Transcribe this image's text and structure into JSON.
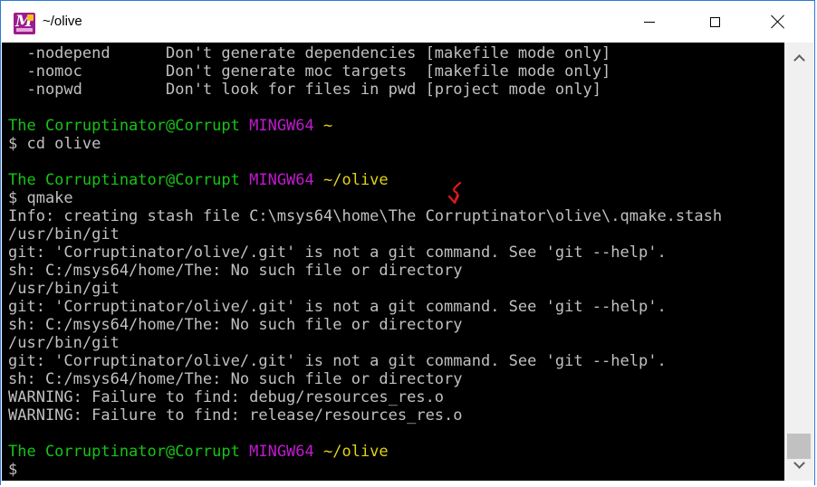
{
  "window": {
    "title": "~/olive",
    "app_icon": "mingw-msys-icon",
    "border_color": "#2b79d6"
  },
  "terminal": {
    "colors": {
      "background": "#000000",
      "text": "#c0c0c0",
      "user": "#17c317",
      "system": "#c21ad0",
      "path": "#dfd21a",
      "annotation": "#e01818"
    },
    "lines": [
      {
        "segments": [
          {
            "text": "  -nodepend      Don't generate dependencies [makefile mode only]",
            "color": "white"
          }
        ]
      },
      {
        "segments": [
          {
            "text": "  -nomoc         Don't generate moc targets  [makefile mode only]",
            "color": "white"
          }
        ]
      },
      {
        "segments": [
          {
            "text": "  -nopwd         Don't look for files in pwd [project mode only]",
            "color": "white"
          }
        ]
      },
      {
        "segments": [
          {
            "text": "",
            "color": "white"
          }
        ]
      },
      {
        "segments": [
          {
            "text": "The Corruptinator@Corrupt",
            "color": "green"
          },
          {
            "text": " MINGW64",
            "color": "mag"
          },
          {
            "text": " ~",
            "color": "yel"
          }
        ]
      },
      {
        "segments": [
          {
            "text": "$ cd olive",
            "color": "white"
          }
        ]
      },
      {
        "segments": [
          {
            "text": "",
            "color": "white"
          }
        ]
      },
      {
        "segments": [
          {
            "text": "The Corruptinator@Corrupt",
            "color": "green"
          },
          {
            "text": " MINGW64",
            "color": "mag"
          },
          {
            "text": " ~/olive",
            "color": "yel"
          }
        ]
      },
      {
        "segments": [
          {
            "text": "$ qmake",
            "color": "white"
          }
        ]
      },
      {
        "segments": [
          {
            "text": "Info: creating stash file C:\\msys64\\home\\The Corruptinator\\olive\\.qmake.stash",
            "color": "white"
          }
        ]
      },
      {
        "segments": [
          {
            "text": "/usr/bin/git",
            "color": "white"
          }
        ]
      },
      {
        "segments": [
          {
            "text": "git: 'Corruptinator/olive/.git' is not a git command. See 'git --help'.",
            "color": "white"
          }
        ]
      },
      {
        "segments": [
          {
            "text": "sh: C:/msys64/home/The: No such file or directory",
            "color": "white"
          }
        ]
      },
      {
        "segments": [
          {
            "text": "/usr/bin/git",
            "color": "white"
          }
        ]
      },
      {
        "segments": [
          {
            "text": "git: 'Corruptinator/olive/.git' is not a git command. See 'git --help'.",
            "color": "white"
          }
        ]
      },
      {
        "segments": [
          {
            "text": "sh: C:/msys64/home/The: No such file or directory",
            "color": "white"
          }
        ]
      },
      {
        "segments": [
          {
            "text": "/usr/bin/git",
            "color": "white"
          }
        ]
      },
      {
        "segments": [
          {
            "text": "git: 'Corruptinator/olive/.git' is not a git command. See 'git --help'.",
            "color": "white"
          }
        ]
      },
      {
        "segments": [
          {
            "text": "sh: C:/msys64/home/The: No such file or directory",
            "color": "white"
          }
        ]
      },
      {
        "segments": [
          {
            "text": "WARNING: Failure to find: debug/resources_res.o",
            "color": "white"
          }
        ]
      },
      {
        "segments": [
          {
            "text": "WARNING: Failure to find: release/resources_res.o",
            "color": "white"
          }
        ]
      },
      {
        "segments": [
          {
            "text": "",
            "color": "white"
          }
        ]
      },
      {
        "segments": [
          {
            "text": "The Corruptinator@Corrupt",
            "color": "green"
          },
          {
            "text": " MINGW64",
            "color": "mag"
          },
          {
            "text": " ~/olive",
            "color": "yel"
          }
        ]
      },
      {
        "segments": [
          {
            "text": "$",
            "color": "white"
          }
        ]
      }
    ],
    "annotation_icon": "red-arrow-annotation-icon"
  },
  "scrollbar": {
    "up_icon": "chevron-up-icon",
    "down_icon": "chevron-down-icon"
  }
}
